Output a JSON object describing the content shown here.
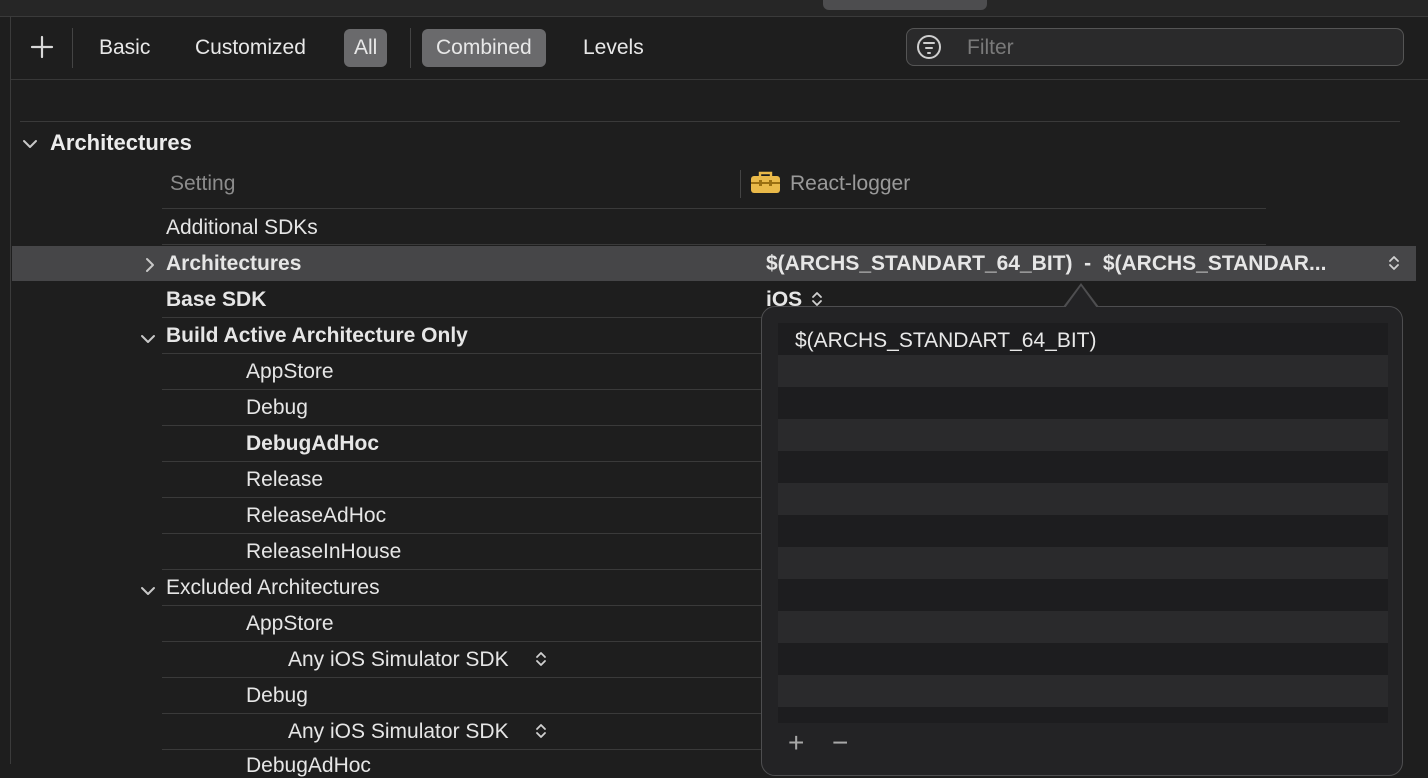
{
  "toolbar": {
    "add_label": "+",
    "basic": "Basic",
    "customized": "Customized",
    "all": "All",
    "combined": "Combined",
    "levels": "Levels",
    "filter_placeholder": "Filter"
  },
  "section": {
    "title": "Architectures",
    "col_setting": "Setting",
    "col_target": "React-logger"
  },
  "rows": {
    "additional_sdks": "Additional SDKs",
    "architectures": "Architectures",
    "architectures_value": "$(ARCHS_STANDART_64_BIT)  -  $(ARCHS_STANDAR...",
    "base_sdk": "Base SDK",
    "base_sdk_value": "iOS",
    "build_active": "Build Active Architecture Only",
    "appstore": "AppStore",
    "debug": "Debug",
    "debug_adhoc": "DebugAdHoc",
    "release": "Release",
    "release_adhoc": "ReleaseAdHoc",
    "release_inhouse": "ReleaseInHouse",
    "excluded": "Excluded Architectures",
    "ex_appstore": "AppStore",
    "ex_appstore_sdk": "Any iOS Simulator SDK",
    "ex_debug": "Debug",
    "ex_debug_sdk": "Any iOS Simulator SDK",
    "ex_debug_adhoc": "DebugAdHoc"
  },
  "popover": {
    "value": "$(ARCHS_STANDART_64_BIT)",
    "add": "+",
    "remove": "−"
  },
  "icons": [
    "plus-icon",
    "filter-icon",
    "chevron-down-icon",
    "chevron-right-icon",
    "toolbox-icon",
    "stepper-icon"
  ],
  "colors": {
    "background": "#1e1e1e",
    "selected_row": "#464648",
    "selected_button": "#6a6a6c",
    "toolbox": "#e9b949"
  }
}
